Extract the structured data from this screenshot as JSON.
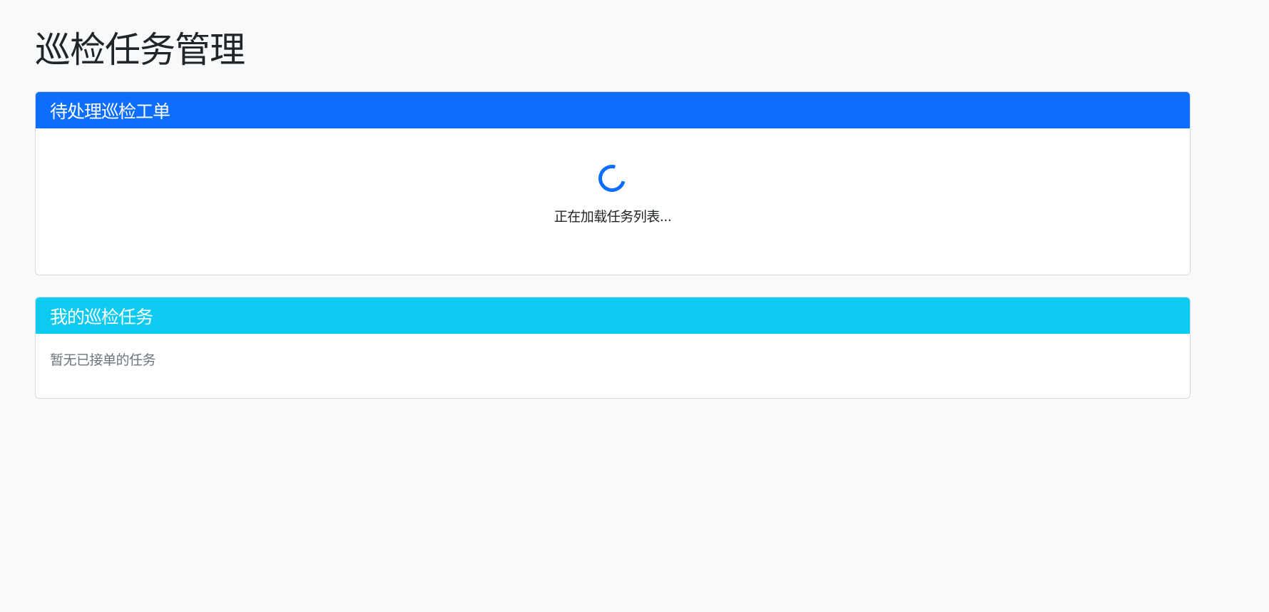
{
  "page": {
    "title": "巡检任务管理"
  },
  "pending_card": {
    "header": "待处理巡检工单",
    "loading_text": "正在加载任务列表...",
    "header_color": "#0d6efd"
  },
  "my_tasks_card": {
    "header": "我的巡检任务",
    "empty_text": "暂无已接单的任务",
    "header_color": "#0dcaf0"
  },
  "icons": {
    "spinner": "loading-spinner-icon"
  }
}
